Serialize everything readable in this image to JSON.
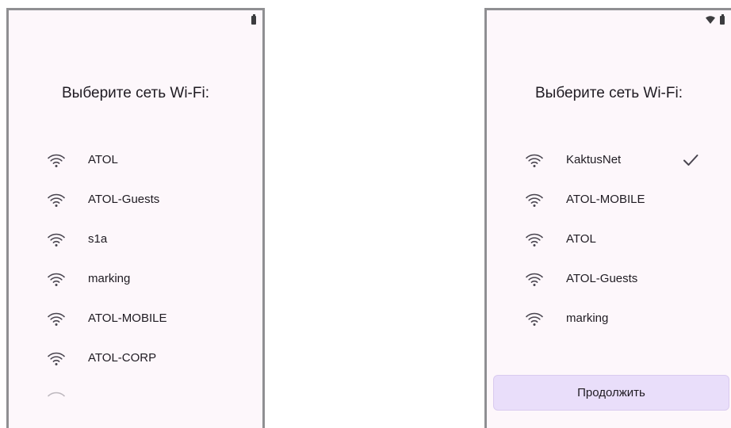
{
  "left_screen": {
    "title": "Выберите сеть Wi-Fi:",
    "status_icons": [
      "battery-icon"
    ],
    "networks": [
      {
        "name": "ATOL",
        "icon": "wifi-icon"
      },
      {
        "name": "ATOL-Guests",
        "icon": "wifi-icon"
      },
      {
        "name": "s1a",
        "icon": "wifi-icon"
      },
      {
        "name": "marking",
        "icon": "wifi-icon"
      },
      {
        "name": "ATOL-MOBILE",
        "icon": "wifi-icon"
      },
      {
        "name": "ATOL-CORP",
        "icon": "wifi-icon"
      }
    ]
  },
  "right_screen": {
    "title": "Выберите сеть Wi-Fi:",
    "status_icons": [
      "wifi-icon",
      "battery-icon"
    ],
    "networks": [
      {
        "name": "KaktusNet",
        "icon": "wifi-icon",
        "selected": true
      },
      {
        "name": "ATOL-MOBILE",
        "icon": "wifi-icon"
      },
      {
        "name": "ATOL",
        "icon": "wifi-icon"
      },
      {
        "name": "ATOL-Guests",
        "icon": "wifi-icon"
      },
      {
        "name": "marking",
        "icon": "wifi-icon"
      }
    ],
    "continue_label": "Продолжить"
  },
  "colors": {
    "screen_bg": "#fdf7fb",
    "button_bg": "#e9defa",
    "text": "#1f1b22"
  }
}
